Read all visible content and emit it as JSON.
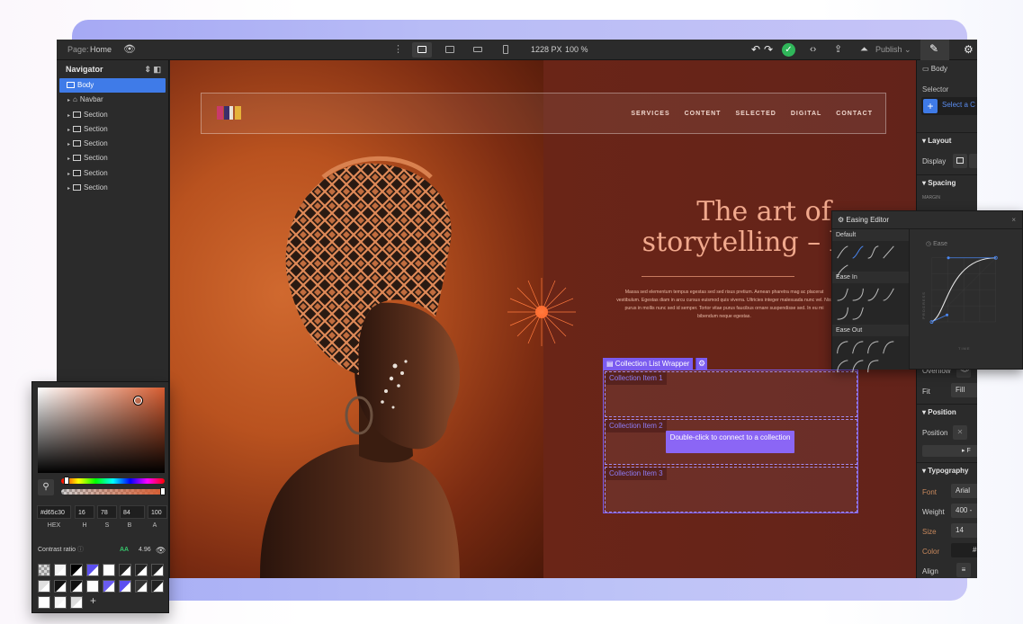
{
  "topbar": {
    "page_label": "Page:",
    "page_name": "Home",
    "width": "1228 PX",
    "zoom": "100 %",
    "publish": "Publish"
  },
  "navigator": {
    "title": "Navigator",
    "items": [
      {
        "label": "Body",
        "selected": true
      },
      {
        "label": "Navbar"
      },
      {
        "label": "Section"
      },
      {
        "label": "Section"
      },
      {
        "label": "Section"
      },
      {
        "label": "Section"
      },
      {
        "label": "Section"
      },
      {
        "label": "Section"
      }
    ]
  },
  "canvas": {
    "nav_links": [
      "SERVICES",
      "CONTENT",
      "SELECTED",
      "DIGITAL",
      "CONTACT"
    ],
    "hero_line1": "The art of",
    "hero_line2": "storytelling – by y",
    "body_text": "Massa sed elementum tempus egestas sed sed risus pretium. Aenean pharetra mag ac placerat vestibulum. Egestas diam in arcu cursus euismod quis viverra. Ultricies integer malesuada nunc vel. Nisl purus in mollis nunc sed id semper. Tortor vitae purus faucibus ornare suspendisse sed. In eu mi bibendum neque egestas.",
    "collection_tag": "Collection List Wrapper",
    "items": [
      "Collection Item 1",
      "Collection Item 2",
      "Collection Item 3"
    ],
    "connect_button": "Double-click to connect to a collection"
  },
  "right_panel": {
    "element": "Body",
    "selector_label": "Selector",
    "selector_placeholder": "Select a C",
    "layout": "Layout",
    "display": "Display",
    "spacing": "Spacing",
    "margin": "MARGIN",
    "overflow": "Overflow",
    "fit": "Fit",
    "fit_value": "Fill",
    "position_section": "Position",
    "position": "Position",
    "typography": "Typography",
    "font": "Font",
    "font_value": "Arial",
    "weight": "Weight",
    "weight_value": "400 -",
    "size": "Size",
    "size_value": "14",
    "color": "Color",
    "color_value": "#",
    "align": "Align"
  },
  "easing_editor": {
    "title": "Easing Editor",
    "groups": [
      "Default",
      "Ease In",
      "Ease Out"
    ],
    "preview_label": "Ease",
    "axis_x": "TIME",
    "axis_y": "PROGRESS"
  },
  "color_picker": {
    "hex": "#d65c30",
    "h": "16",
    "s": "78",
    "b": "84",
    "a": "100",
    "labels": [
      "HEX",
      "H",
      "S",
      "B",
      "A"
    ],
    "contrast_label": "Contrast ratio",
    "contrast_rating": "AA",
    "contrast_value": "4.96",
    "add": "+"
  },
  "colors": {
    "accent_blue": "#3f7be8",
    "collection_purple": "#7b5cf0",
    "hero_text": "#f1a98d",
    "picked": "#d65c30"
  }
}
